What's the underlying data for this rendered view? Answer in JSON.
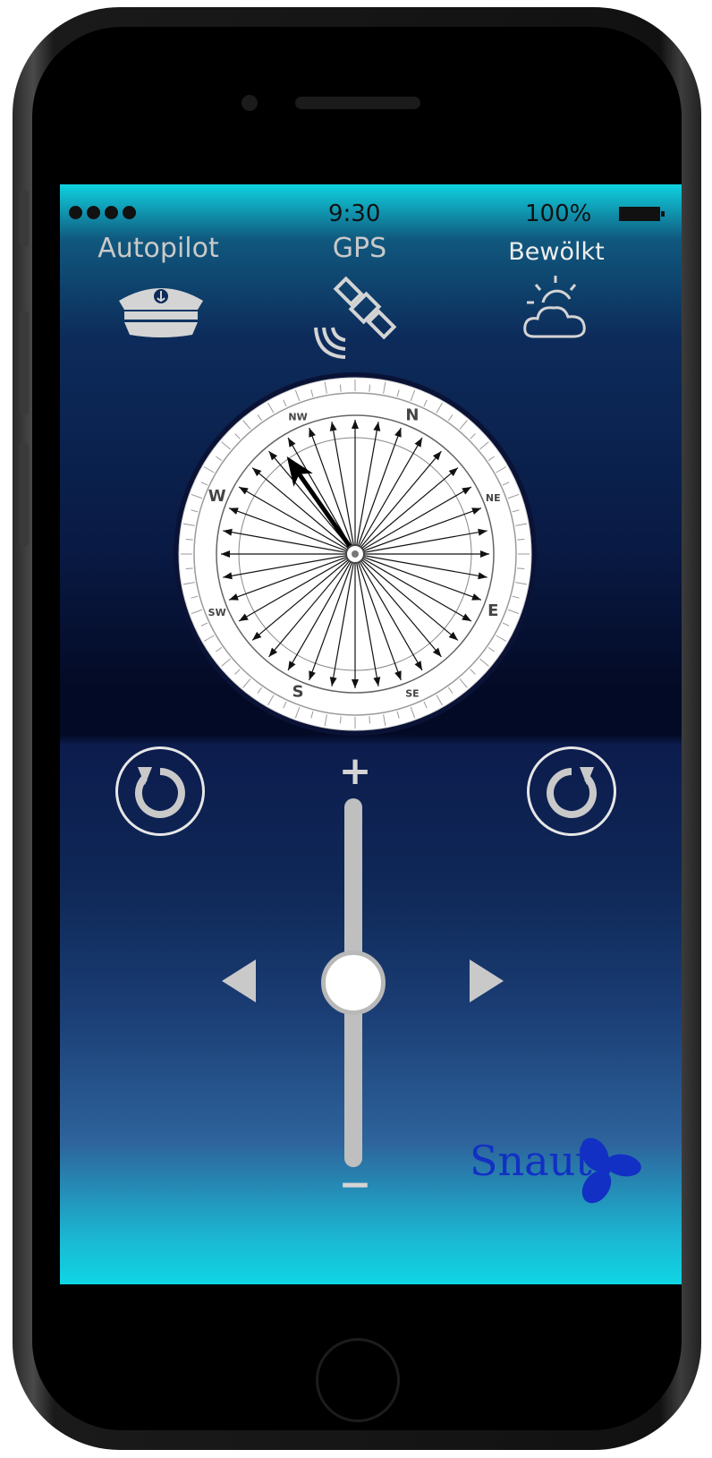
{
  "status_bar": {
    "signal_dots": 4,
    "time": "9:30",
    "battery": "100%"
  },
  "header": {
    "autopilot_label": "Autopilot",
    "gps_label": "GPS",
    "weather_label": "Bewölkt"
  },
  "icons": {
    "autopilot": "captain-hat-icon",
    "gps": "satellite-icon",
    "weather": "partly-cloudy-icon",
    "rotate_left": "rotate-left-icon",
    "rotate_right": "rotate-right-icon"
  },
  "compass": {
    "cardinals": [
      "N",
      "NE",
      "E",
      "SE",
      "S",
      "SW",
      "W",
      "NW"
    ],
    "heading_degrees": 325
  },
  "controls": {
    "plus_label": "+",
    "minus_label": "−",
    "slider_level": 0.5
  },
  "brand": {
    "logo_text": "Snaut",
    "color": "#1230c4"
  },
  "colors": {
    "accent": "#0fd6e4",
    "control": "#c9c9c9"
  }
}
